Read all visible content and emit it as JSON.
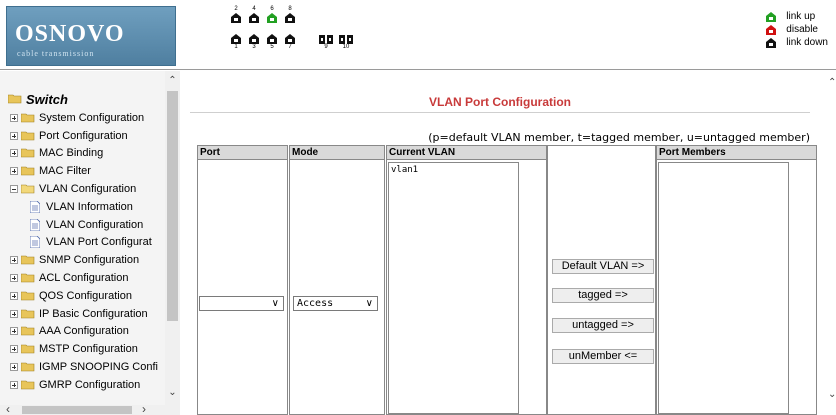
{
  "header": {
    "brand": "OSNOVO",
    "tagline": "cable transmission",
    "ports_top": [
      "2",
      "4",
      "6",
      "8"
    ],
    "ports_bottom": [
      "1",
      "3",
      "5",
      "7",
      "9",
      "10"
    ],
    "legend": [
      {
        "label": "link up",
        "color": "#22a022"
      },
      {
        "label": "disable",
        "color": "#d01010"
      },
      {
        "label": "link down",
        "color": "#111111"
      }
    ],
    "port4_status": "link up"
  },
  "sidebar": {
    "root": "Switch",
    "items": [
      {
        "label": "System Configuration",
        "expanded": false
      },
      {
        "label": "Port Configuration",
        "expanded": false
      },
      {
        "label": "MAC Binding",
        "expanded": false
      },
      {
        "label": "MAC Filter",
        "expanded": false
      },
      {
        "label": "VLAN Configuration",
        "expanded": true
      },
      {
        "label": "VLAN Information",
        "child": true
      },
      {
        "label": "VLAN Configuration",
        "child": true
      },
      {
        "label": "VLAN Port Configurat",
        "child": true
      },
      {
        "label": "SNMP Configuration",
        "expanded": false
      },
      {
        "label": "ACL Configuration",
        "expanded": false
      },
      {
        "label": "QOS Configuration",
        "expanded": false
      },
      {
        "label": "IP Basic Configuration",
        "expanded": false
      },
      {
        "label": "AAA Configuration",
        "expanded": false
      },
      {
        "label": "MSTP Configuration",
        "expanded": false
      },
      {
        "label": "IGMP SNOOPING Confi",
        "expanded": false
      },
      {
        "label": "GMRP Configuration",
        "expanded": false
      }
    ]
  },
  "main": {
    "title": "VLAN Port Configuration",
    "hint": "(p=default VLAN member, t=tagged member, u=untagged member)",
    "columns": {
      "port": "Port",
      "mode": "Mode",
      "current_vlan": "Current VLAN",
      "port_members": "Port Members"
    },
    "port_select_value": "",
    "mode_select_value": "Access",
    "current_vlan_items": [
      "vlan1"
    ],
    "port_members_items": [],
    "buttons": {
      "default_vlan": "Default  VLAN =>",
      "tagged": "tagged =>",
      "untagged": "untagged =>",
      "unmember": "unMember <="
    }
  },
  "colors": {
    "title_red": "#c83a3a",
    "header_gray": "#d9d9d9"
  }
}
